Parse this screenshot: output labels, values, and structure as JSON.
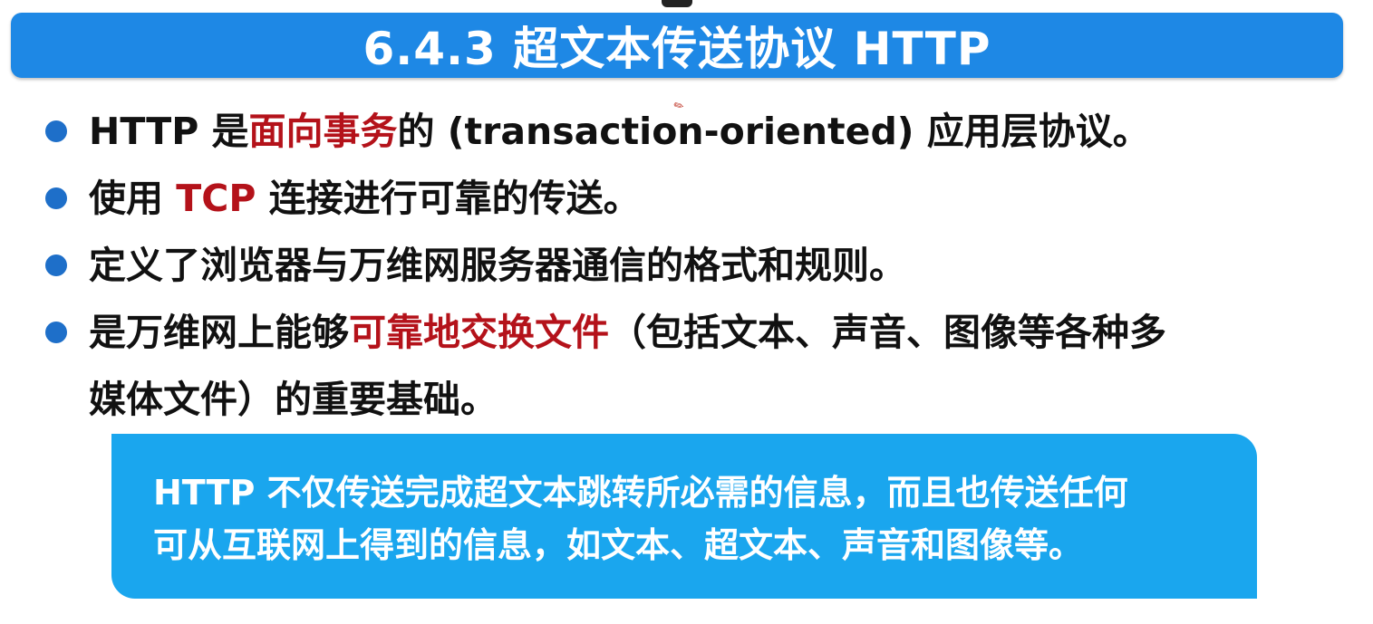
{
  "title": "6.4.3  超文本传送协议 HTTP",
  "bullets": [
    {
      "parts": [
        "HTTP 是",
        "面向事务",
        "的 (transaction-oriented) 应用层协议。"
      ]
    },
    {
      "parts": [
        "使用 ",
        "TCP",
        " 连接进行可靠的传送。"
      ]
    },
    {
      "parts": [
        "定义了浏览器与万维网服务器通信的格式和规则。"
      ]
    },
    {
      "parts": [
        "是万维网上能够",
        "可靠地交换文件",
        "（包括文本、声音、图像等各种多",
        "媒体文件）的重要基础。"
      ]
    }
  ],
  "note": {
    "line1": "HTTP 不仅传送完成超文本跳转所必需的信息，而且也传送任何",
    "line2": "可从互联网上得到的信息，如文本、超文本、声音和图像等。"
  },
  "colors": {
    "title_bg": "#1e88e5",
    "highlight": "#b4121a",
    "bullet_dot": "#1e6fc9",
    "note_bg": "#1aa6ee"
  },
  "icons": {
    "pen_mark": "pen-cursor-icon"
  }
}
